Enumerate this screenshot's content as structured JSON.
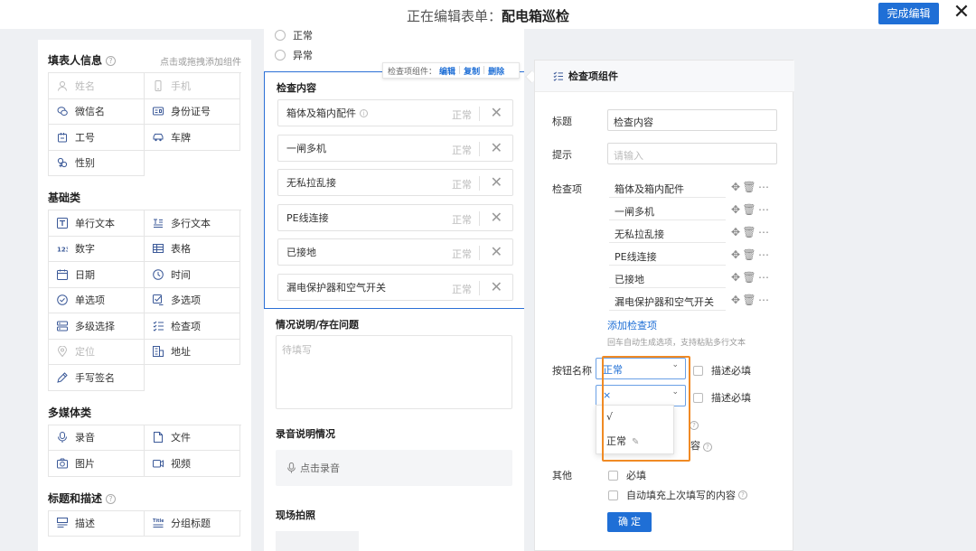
{
  "header": {
    "title_prefix": "正在编辑表单：",
    "form_name": "配电箱巡检",
    "done_label": "完成编辑",
    "close_glyph": "✕"
  },
  "palette": {
    "sections": [
      {
        "title": "填表人信息",
        "hint": "点击或拖拽添加组件",
        "items": [
          {
            "label": "姓名",
            "icon": "person-icon",
            "disabled": true
          },
          {
            "label": "手机",
            "icon": "phone-icon",
            "disabled": true
          },
          {
            "label": "微信名",
            "icon": "wechat-icon",
            "disabled": false
          },
          {
            "label": "身份证号",
            "icon": "id-card-icon",
            "disabled": false
          },
          {
            "label": "工号",
            "icon": "badge-icon",
            "disabled": false
          },
          {
            "label": "车牌",
            "icon": "car-icon",
            "disabled": false
          },
          {
            "label": "性别",
            "icon": "gender-icon",
            "disabled": false
          }
        ]
      },
      {
        "title": "基础类",
        "hint": "",
        "items": [
          {
            "label": "单行文本",
            "icon": "text-icon",
            "disabled": false
          },
          {
            "label": "多行文本",
            "icon": "multiline-text-icon",
            "disabled": false
          },
          {
            "label": "数字",
            "icon": "number-icon",
            "disabled": false
          },
          {
            "label": "表格",
            "icon": "table-icon",
            "disabled": false
          },
          {
            "label": "日期",
            "icon": "calendar-icon",
            "disabled": false
          },
          {
            "label": "时间",
            "icon": "clock-icon",
            "disabled": false
          },
          {
            "label": "单选项",
            "icon": "radio-icon",
            "disabled": false
          },
          {
            "label": "多选项",
            "icon": "checkbox-icon",
            "disabled": false
          },
          {
            "label": "多级选择",
            "icon": "cascade-icon",
            "disabled": false
          },
          {
            "label": "检查项",
            "icon": "checklist-icon",
            "disabled": false
          },
          {
            "label": "定位",
            "icon": "location-icon",
            "disabled": true
          },
          {
            "label": "地址",
            "icon": "address-icon",
            "disabled": false
          },
          {
            "label": "手写签名",
            "icon": "signature-icon",
            "disabled": false
          }
        ]
      },
      {
        "title": "多媒体类",
        "hint": "",
        "items": [
          {
            "label": "录音",
            "icon": "microphone-icon",
            "disabled": false
          },
          {
            "label": "文件",
            "icon": "file-icon",
            "disabled": false
          },
          {
            "label": "图片",
            "icon": "camera-icon",
            "disabled": false
          },
          {
            "label": "视频",
            "icon": "video-icon",
            "disabled": false
          }
        ]
      },
      {
        "title": "标题和描述",
        "hint": "",
        "items": [
          {
            "label": "描述",
            "icon": "description-icon",
            "disabled": false
          },
          {
            "label": "分组标题",
            "icon": "group-title-icon",
            "disabled": false
          }
        ]
      }
    ]
  },
  "form": {
    "radio_options": [
      "正常",
      "异常"
    ],
    "check_block": {
      "title": "检查内容",
      "status": "正常",
      "items": [
        "箱体及箱内配件",
        "一闸多机",
        "无私拉乱接",
        "PE线连接",
        "已接地",
        "漏电保护器和空气开关"
      ]
    },
    "toolbar": {
      "prefix": "检查项组件：",
      "edit": "编辑",
      "copy": "复制",
      "delete": "删除"
    },
    "situation": {
      "title": "情况说明/存在问题",
      "placeholder": "待填写"
    },
    "recording": {
      "title": "录音说明情况",
      "button": "点击录音"
    },
    "photo": {
      "title": "现场拍照"
    }
  },
  "panel": {
    "title": "检查项组件",
    "label_title": "标题",
    "title_value": "检查内容",
    "label_hint": "提示",
    "hint_placeholder": "请输入",
    "label_items": "检查项",
    "items": [
      "箱体及箱内配件",
      "一闸多机",
      "无私拉乱接",
      "PE线连接",
      "已接地",
      "漏电保护器和空气开关"
    ],
    "add_item": "添加检查项",
    "add_hint": "回车自动生成选项，支持粘贴多行文本",
    "label_buttons": "按钮名称",
    "button1_value": "正常",
    "button2_value": "×",
    "describe_required": "描述必填",
    "dropdown_options": [
      "√",
      "正常"
    ],
    "peek_text": "容",
    "label_other": "其他",
    "required": "必填",
    "autofill": "自动填充上次填写的内容",
    "confirm": "确 定"
  }
}
